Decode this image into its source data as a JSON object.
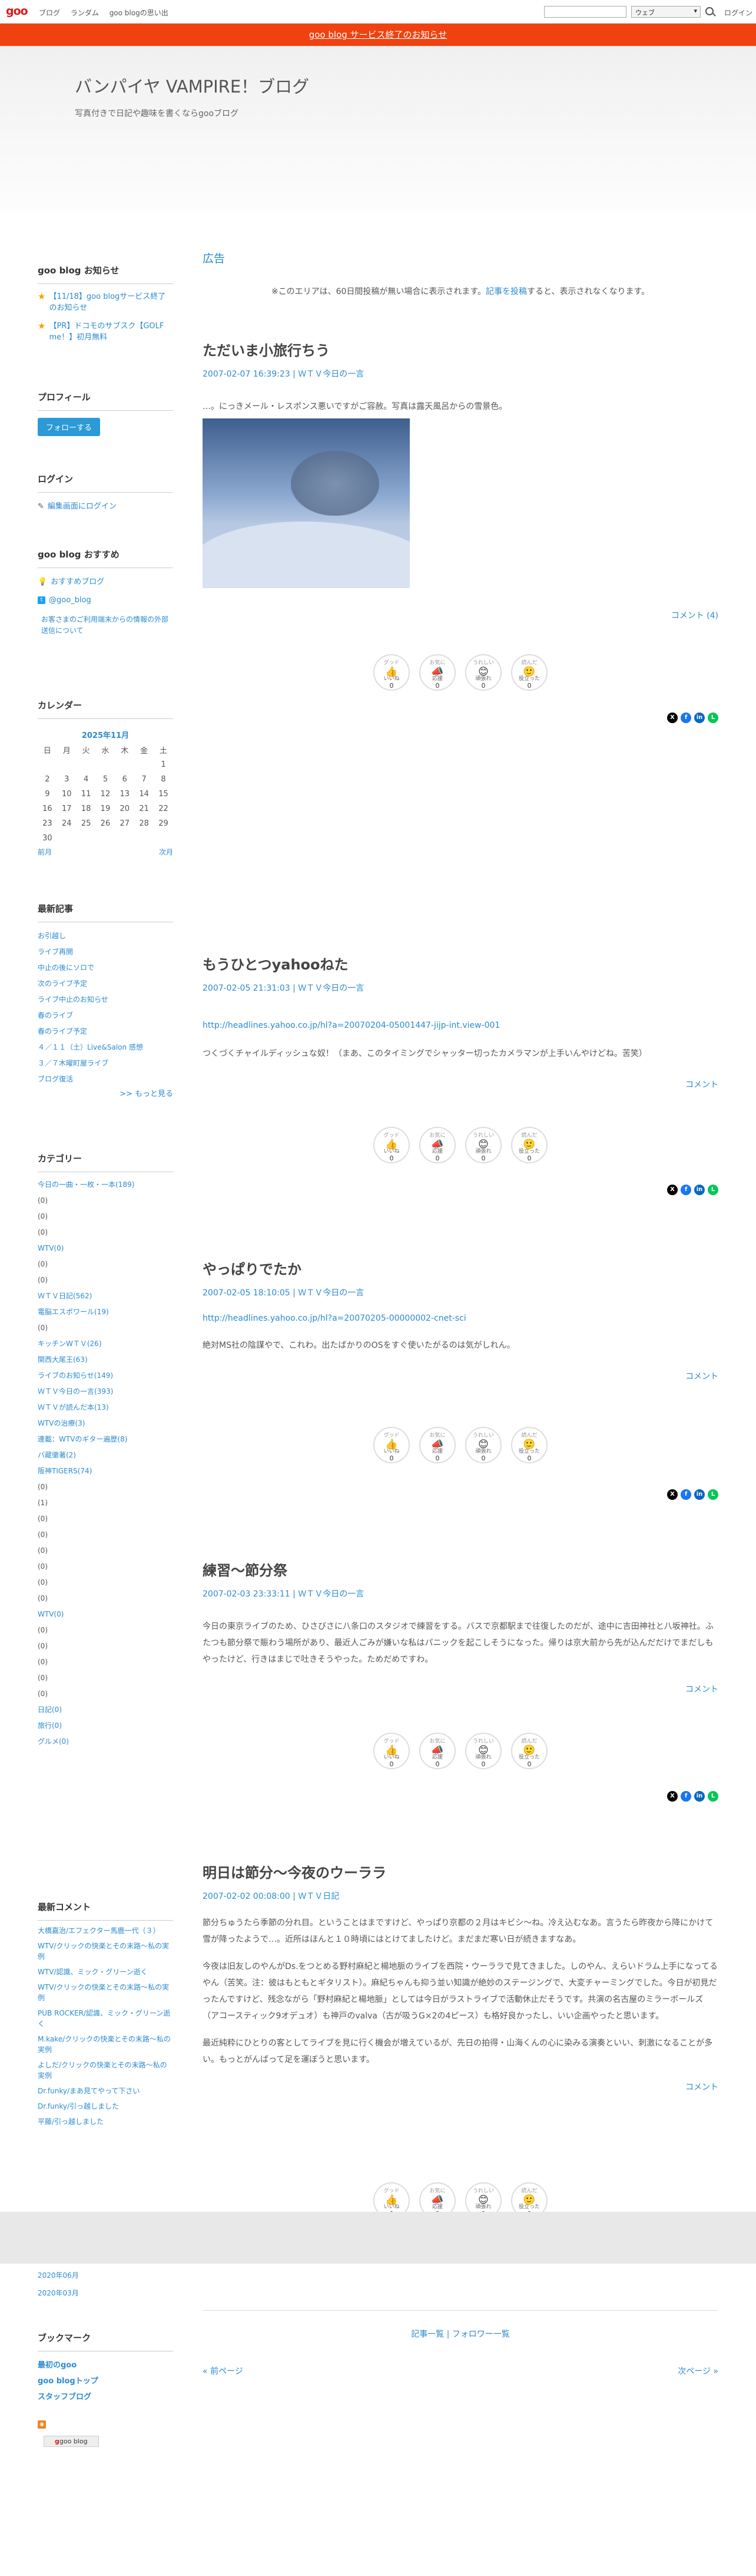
{
  "topbar": {
    "logo": "goo",
    "links": [
      "ブログ",
      "ランダム",
      "goo blogの思い出"
    ],
    "search_select": "ウェブ",
    "login": "ログイン"
  },
  "notice": "goo blog サービス終了のお知らせ",
  "header": {
    "title": "バンパイヤ VAMPIRE！ブログ",
    "description": "写真付きで日記や趣味を書くならgooブログ"
  },
  "sidebar": {
    "news_title": "goo blog お知らせ",
    "news": [
      "【11/18】goo blogサービス終了のお知らせ",
      "【PR】ドコモのサブスク【GOLF me！】初月無料"
    ],
    "profile_title": "プロフィール",
    "follow": "フォローする",
    "login_title": "ログイン",
    "login_link": "編集画面にログイン",
    "recommend_title": "goo blog おすすめ",
    "recommend": [
      "おすすめブログ",
      "@goo_blog"
    ],
    "recommend_note": "お客さまのご利用端末からの情報の外部送信について",
    "calendar_title": "カレンダー",
    "calendar": {
      "caption": "2025年11月",
      "weekdays": [
        "日",
        "月",
        "火",
        "水",
        "木",
        "金",
        "土"
      ],
      "weeks": [
        [
          "",
          "",
          "",
          "",
          "",
          "",
          "1"
        ],
        [
          "2",
          "3",
          "4",
          "5",
          "6",
          "7",
          "8"
        ],
        [
          "9",
          "10",
          "11",
          "12",
          "13",
          "14",
          "15"
        ],
        [
          "16",
          "17",
          "18",
          "19",
          "20",
          "21",
          "22"
        ],
        [
          "23",
          "24",
          "25",
          "26",
          "27",
          "28",
          "29"
        ],
        [
          "30",
          "",
          "",
          "",
          "",
          "",
          ""
        ]
      ],
      "prev": "前月",
      "next": "次月"
    },
    "recent_title": "最新記事",
    "recent": [
      "お引越し",
      "ライブ再開",
      "中止の後にソロで",
      "次のライブ予定",
      "ライブ中止のお知らせ",
      "春のライブ",
      "春のライブ予定",
      "４／１１（土）Live&Salon 感想",
      "３／７木曜町屋ライブ",
      "ブログ復活"
    ],
    "more": ">> もっと見る",
    "category_title": "カテゴリー",
    "categories": [
      "今日の一曲・一枚・一本(189)",
      "(0)",
      "(0)",
      "(0)",
      "WTV(0)",
      "(0)",
      "(0)",
      "ＷＴＶ日記(562)",
      "電脳エスポワール(19)",
      "(0)",
      "キッチンWＴＶ(26)",
      "関西大尾王(63)",
      "ライブのお知らせ(149)",
      "ＷＴＶ今日の一言(393)",
      "ＷＴＶが読んだ本(13)",
      "WTVの治療(3)",
      "連載：WTVのギター遍歴(8)",
      "バ蔵徹著(2)",
      "阪神TIGERS(74)",
      "(0)",
      "(1)",
      "(0)",
      "(0)",
      "(0)",
      "(0)",
      "(0)",
      "(0)",
      "WTV(0)",
      "(0)",
      "(0)",
      "(0)",
      "(0)",
      "(0)",
      "日記(0)",
      "旅行(0)",
      "グルメ(0)"
    ],
    "comments_title": "最新コメント",
    "comments": [
      "大橋嘉治/エフェクター馬鹿一代（３）",
      "WTV/クリックの快楽とその末路〜私の実例",
      "WTV/認識、ミック・グリーン逝く",
      "WTV/クリックの快楽とその末路〜私の実例",
      "PUB ROCKER/認識、ミック・グリーン逝く",
      "M.kake/クリックの快楽とその末路〜私の実例",
      "よしだ/クリックの快楽とその末路〜私の実例",
      "Dr.funky/まあ見てやって下さい",
      "Dr.funky/引っ越しました",
      "平藤/引っ越しました"
    ],
    "archives": [
      "2020年06月",
      "2020年03月"
    ],
    "bookmark_title": "ブックマーク",
    "bookmarks": [
      "最初のgoo",
      "goo blogトップ",
      "スタッフブログ"
    ],
    "badge": "goo blog"
  },
  "main": {
    "ad_heading": "広告",
    "ad_text_before": "※このエリアは、60日間投稿が無い場合に表示されます。",
    "ad_text_link": "記事を投稿",
    "ad_text_after": "すると、表示されなくなります。",
    "posts": [
      {
        "title": "ただいま小旅行ちう",
        "meta": "2007-02-07 16:39:23 | ＷＴＶ今日の一言",
        "body": "…。にっきメール・レスポンス悪いですがご容赦。写真は露天風呂からの雪景色。",
        "comment": "コメント (4)"
      },
      {
        "title": "もうひとつyahooねた",
        "meta": "2007-02-05 21:31:03 | ＷＴＶ今日の一言",
        "link": "http://headlines.yahoo.co.jp/hl?a=20070204-05001447-jijp-int.view-001",
        "body": "つくづくチャイルディッシュな奴！（まあ、このタイミングでシャッター切ったカメラマンが上手いんやけどね。苦笑）",
        "comment": "コメント"
      },
      {
        "title": "やっぱりでたか",
        "meta": "2007-02-05 18:10:05 | ＷＴＶ今日の一言",
        "link": "http://headlines.yahoo.co.jp/hl?a=20070205-00000002-cnet-sci",
        "body": "絶対MS社の陰謀やで、これわ。出たばかりのOSをすぐ使いたがるのは気がしれん。",
        "comment": "コメント"
      },
      {
        "title": "練習～節分祭",
        "meta": "2007-02-03 23:33:11 | ＷＴＶ今日の一言",
        "body": "今日の東京ライブのため、ひさびさに八条口のスタジオで練習をする。バスで京都駅まで往復したのだが、途中に吉田神社と八坂神社。ふたつも節分祭で賑わう場所があり、最近人ごみが嫌いな私はパニックを起こしそうになった。帰りは京大前から先が込んだだけでまだしもやったけど、行きはまじで吐きそうやった。ためだめですわ。",
        "comment": "コメント"
      },
      {
        "title": "明日は節分～今夜のウーララ",
        "meta": "2007-02-02 00:08:00 | ＷＴＶ日記",
        "paragraphs": [
          "節分ちゅうたら季節の分れ目。ということはまですけど、やっぱり京都の２月はキビシ～ね。冷え込むなあ。言うたら昨夜から降にかけて雪が降ったようで…。近所はほんと１０時頃にはとけてましたけど。まだまだ寒い日が続きますなあ。",
          "今夜は旧友しのやんがDs.をつとめる野村麻紀と楊地脈のライブを西院・ウーララで見てきました。しのやん、えらいドラム上手になってるやん（苦笑。注：彼はもともとギタリスト）。麻紀ちゃんも抑う並い知識が絶妙のステージングで、大変チャーミングでした。今日が初見だったんですけど、残念ながら「野村麻紀と楊地脈」としては今日がラストライブで活動休止だそうです。共演の名古屋のミラーボールズ（アコースティック9オデュオ）も神戸のvalva（古が吸うG×2の4ピース）も格好良かったし、いい企画やったと思います。",
          "最近純粋にひとりの客としてライブを見に行く機会が増えているが、先日の拍得・山海くんの心に染みる演奏といい、刺激になることが多い。もっとがんばって足を運ぼうと思います。"
        ],
        "comment": "コメント"
      }
    ],
    "reactions": [
      {
        "cap": "グッド",
        "label": "いいね",
        "glyph": "👍",
        "count": "0"
      },
      {
        "cap": "お気に",
        "label": "応援",
        "glyph": "📣",
        "count": "0"
      },
      {
        "cap": "うれしい",
        "label": "頑張れ",
        "glyph": "😊",
        "count": "0"
      },
      {
        "cap": "読んだ",
        "label": "役立った",
        "glyph": "🙂",
        "count": "0"
      }
    ],
    "pager": "記事一覧 | フォロワー一覧",
    "prev": "« 前ページ",
    "next": "次ページ »"
  },
  "colors": {
    "accent": "#2b8bd0",
    "notice": "#f04210",
    "logo": "#e0191a"
  }
}
